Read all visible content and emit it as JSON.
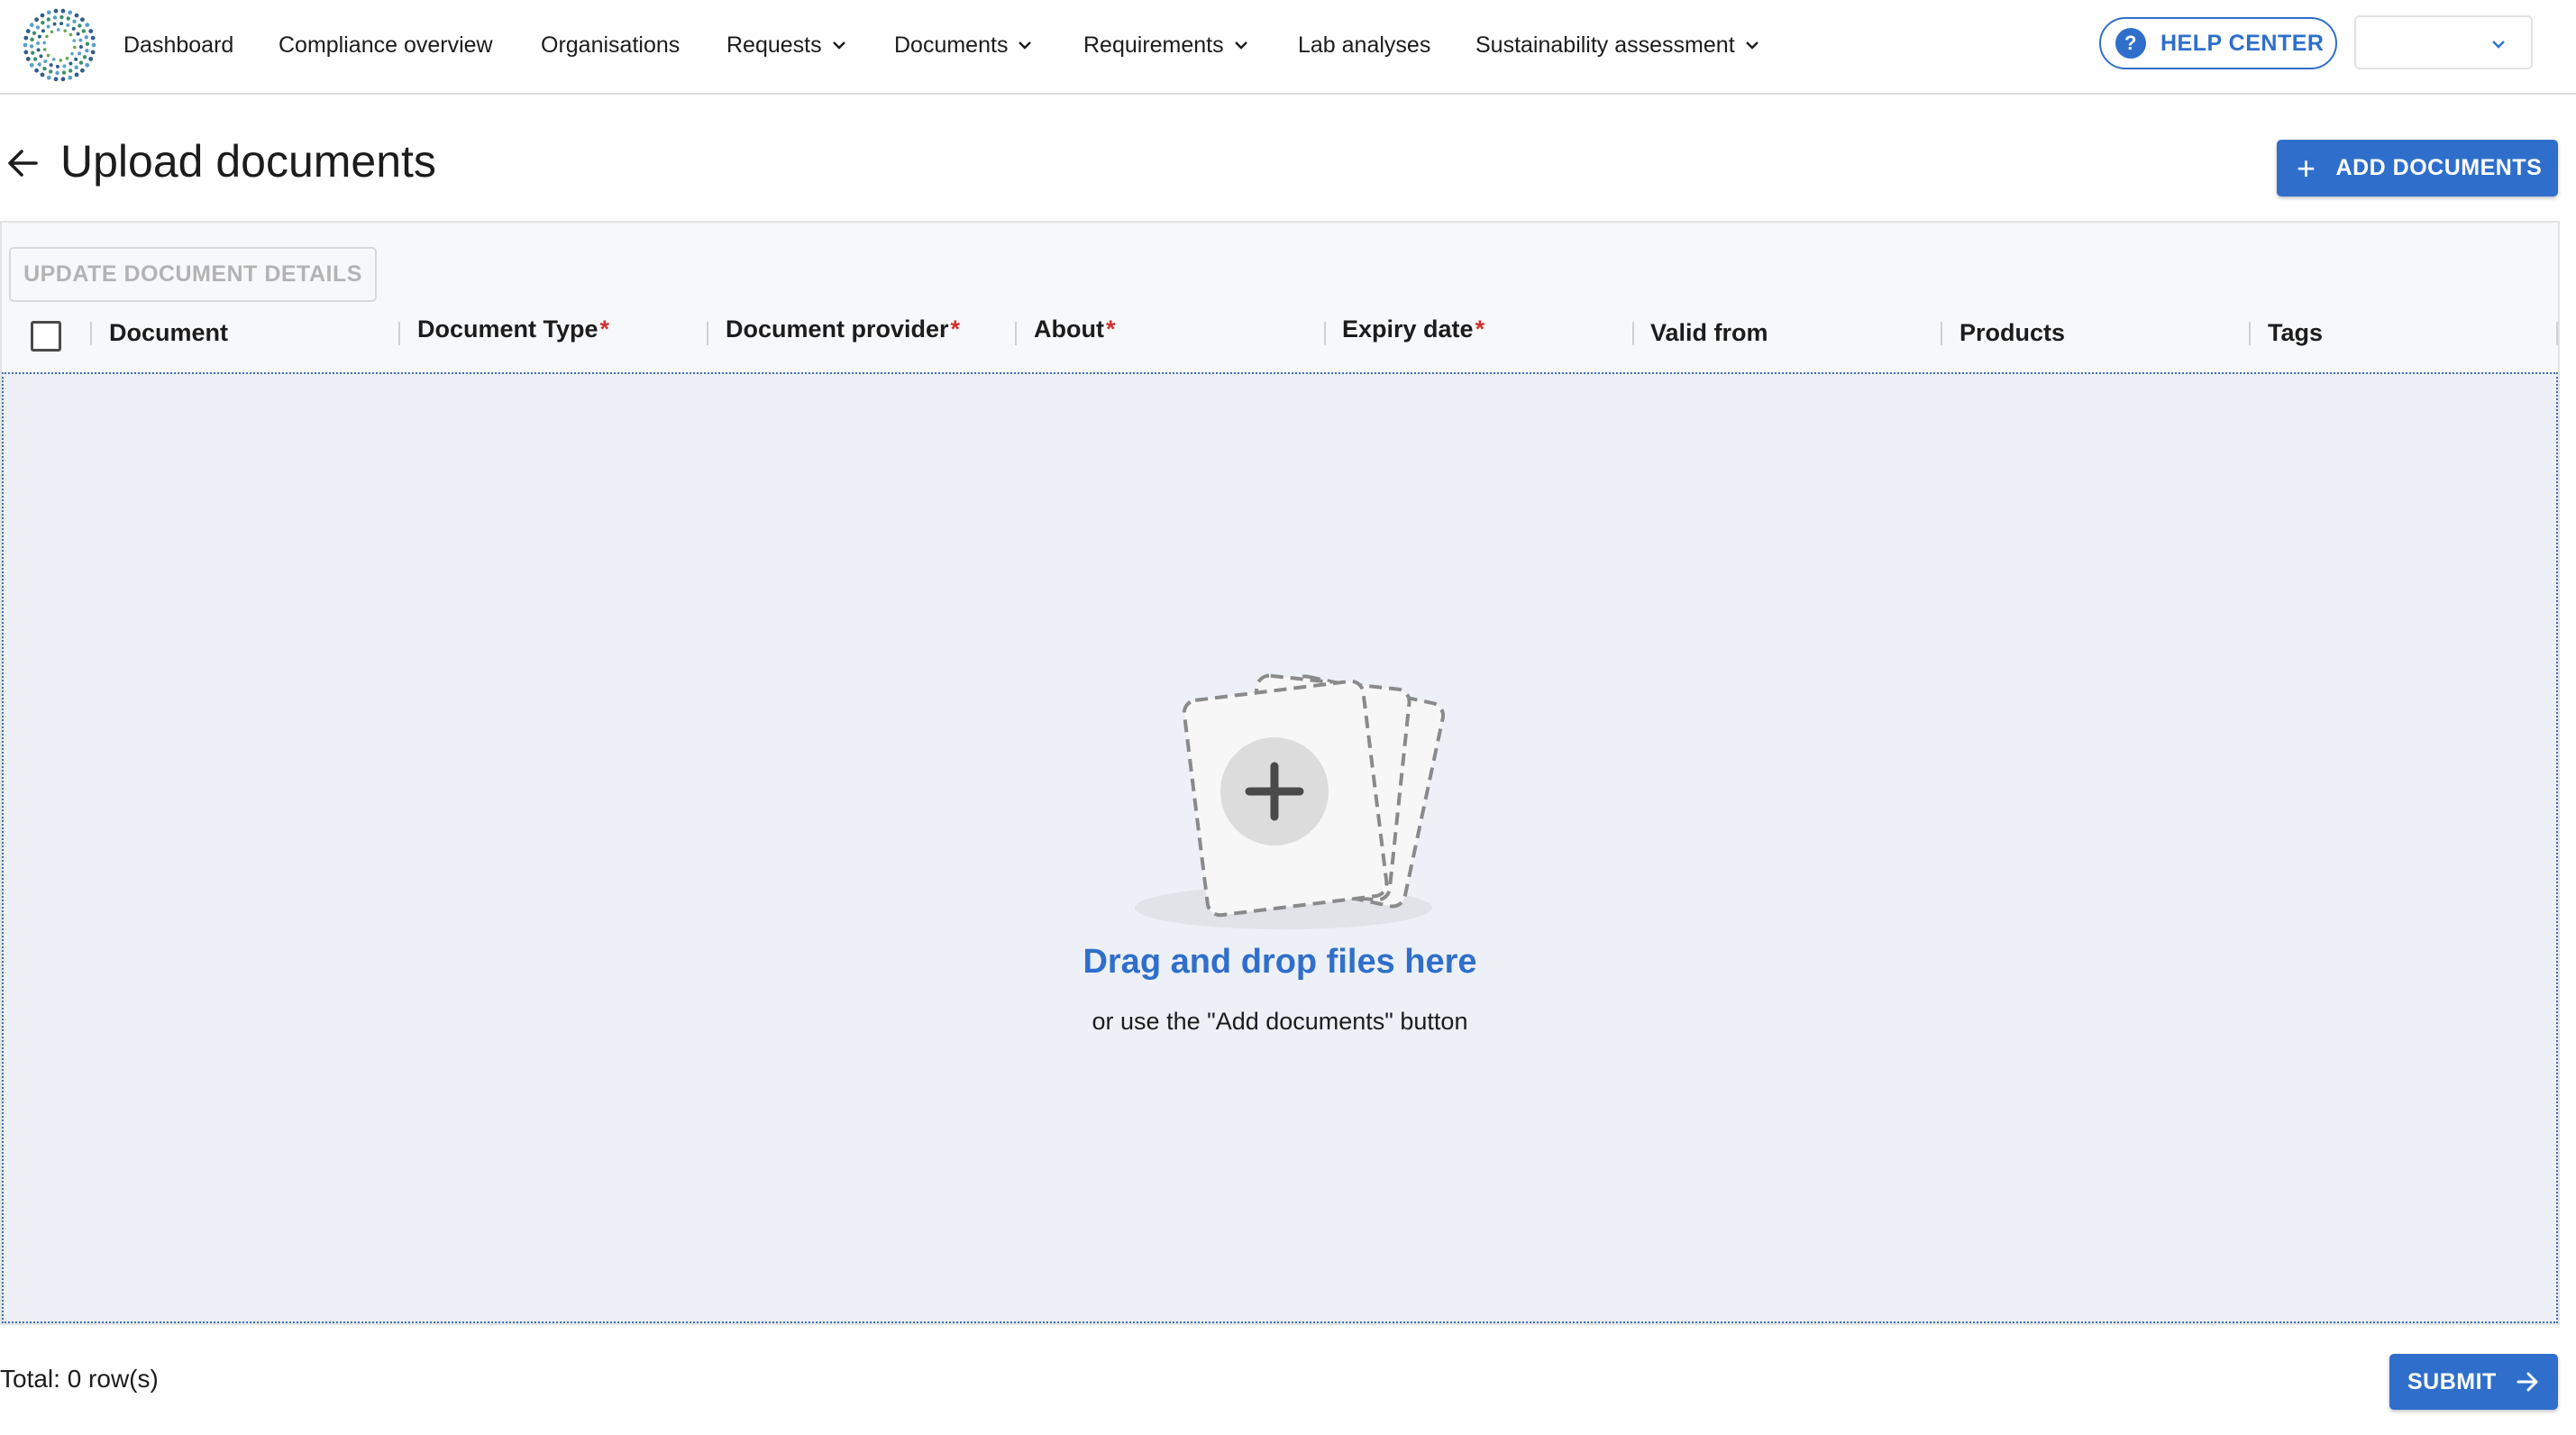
{
  "nav": {
    "items": [
      {
        "label": "Dashboard",
        "dropdown": false
      },
      {
        "label": "Compliance overview",
        "dropdown": false
      },
      {
        "label": "Organisations",
        "dropdown": false
      },
      {
        "label": "Requests",
        "dropdown": true
      },
      {
        "label": "Documents",
        "dropdown": true
      },
      {
        "label": "Requirements",
        "dropdown": true
      },
      {
        "label": "Lab analyses",
        "dropdown": false
      },
      {
        "label": "Sustainability assessment",
        "dropdown": true
      }
    ],
    "help_label": "HELP CENTER",
    "help_icon": "question-circle-icon",
    "user_select_value": ""
  },
  "header": {
    "title": "Upload documents",
    "add_button_label": "ADD DOCUMENTS"
  },
  "table": {
    "update_button_label": "UPDATE DOCUMENT DETAILS",
    "columns": [
      {
        "label": "Document",
        "required": false
      },
      {
        "label": "Document Type",
        "required": true
      },
      {
        "label": "Document provider",
        "required": true
      },
      {
        "label": "About",
        "required": true
      },
      {
        "label": "Expiry date",
        "required": true
      },
      {
        "label": "Valid from",
        "required": false
      },
      {
        "label": "Products",
        "required": false
      },
      {
        "label": "Tags",
        "required": false
      }
    ],
    "required_marker": "*",
    "rows": []
  },
  "dropzone": {
    "title": "Drag and drop files here",
    "subtitle": "or use the \"Add documents\" button"
  },
  "footer": {
    "total_text": "Total: 0 row(s)",
    "submit_label": "SUBMIT"
  },
  "colors": {
    "accent": "#2f6fcb",
    "required": "#d32f2f",
    "dropzone_bg": "#edf0f7"
  }
}
